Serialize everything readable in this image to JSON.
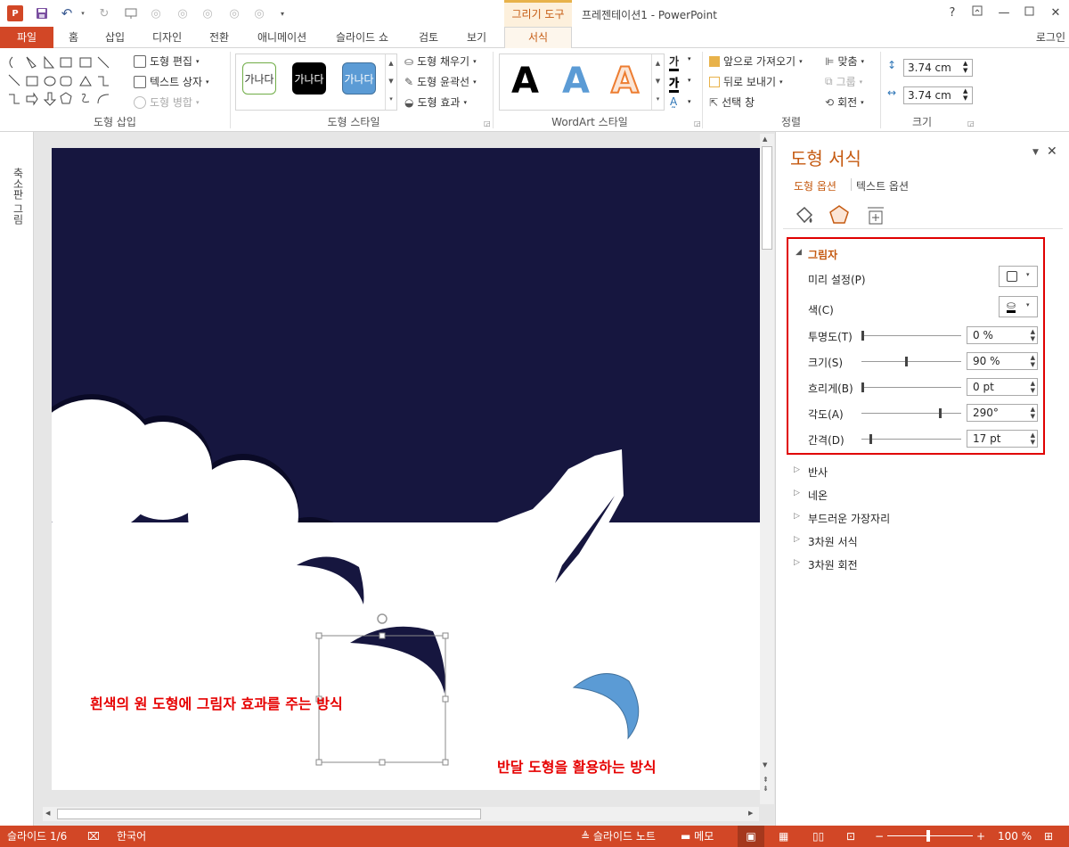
{
  "window": {
    "context_tab_group": "그리기 도구",
    "title": "프레젠테이션1 - PowerPoint",
    "help": "?",
    "login": "로그인"
  },
  "tabs": {
    "file": "파일",
    "items": [
      "홈",
      "삽입",
      "디자인",
      "전환",
      "애니메이션",
      "슬라이드 쇼",
      "검토",
      "보기"
    ],
    "active": "서식"
  },
  "ribbon": {
    "insert_shapes": {
      "label": "도형 삽입",
      "edit_shape": "도형 편집",
      "text_box": "텍스트 상자",
      "merge_shapes": "도형 병합"
    },
    "shape_styles": {
      "label": "도형 스타일",
      "samples": [
        "가나다",
        "가나다",
        "가나다"
      ],
      "fill": "도형 채우기",
      "outline": "도형 윤곽선",
      "effects": "도형 효과"
    },
    "wordart": {
      "label": "WordArt 스타일",
      "samples": [
        "A",
        "A",
        "A"
      ],
      "text_fill_glyph": "가"
    },
    "arrange": {
      "label": "정렬",
      "bring_forward": "앞으로 가져오기",
      "send_backward": "뒤로 보내기",
      "selection_pane": "선택 창",
      "align": "맞춤",
      "group": "그룹",
      "rotate": "회전"
    },
    "size": {
      "label": "크기",
      "height": "3.74 cm",
      "width": "3.74 cm"
    }
  },
  "sidebar": {
    "thumbnails_label": "축소판 그림"
  },
  "slide": {
    "caption_left": "흰색의 원 도형에 그림자 효과를 주는 방식",
    "caption_right": "반달 도형을 활용하는 방식",
    "colors": {
      "night_sky": "#16163f",
      "cloud": "#ffffff",
      "caption": "#e60000",
      "moon": "#5b9bd5"
    }
  },
  "format_pane": {
    "title": "도형 서식",
    "tab_shape_options": "도형 옵션",
    "tab_text_options": "텍스트 옵션",
    "shadow": {
      "header": "그림자",
      "preset_label": "미리 설정(P)",
      "color_label": "색(C)",
      "rows": [
        {
          "label": "투명도(T)",
          "value": "0 %",
          "level": 0.0
        },
        {
          "label": "크기(S)",
          "value": "90 %",
          "level": 0.45
        },
        {
          "label": "흐리게(B)",
          "value": "0 pt",
          "level": 0.0
        },
        {
          "label": "각도(A)",
          "value": "290°",
          "level": 0.806
        },
        {
          "label": "간격(D)",
          "value": "17 pt",
          "level": 0.085
        }
      ]
    },
    "sections": [
      "반사",
      "네온",
      "부드러운 가장자리",
      "3차원 서식",
      "3차원 회전"
    ]
  },
  "statusbar": {
    "slide_counter": "슬라이드 1/6",
    "language": "한국어",
    "notes": "슬라이드 노트",
    "comments": "메모",
    "zoom": "100 %"
  }
}
